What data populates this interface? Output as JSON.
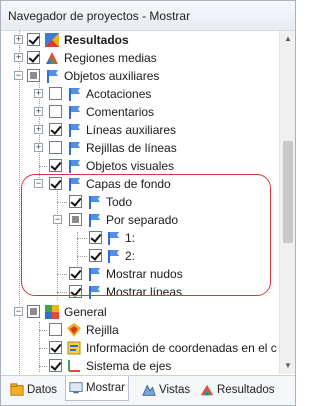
{
  "window": {
    "title": "Navegador de proyectos - Mostrar"
  },
  "tree": [
    {
      "label": "Resultados",
      "bold": true,
      "expander": "+",
      "check": "checked",
      "icon": "results-icon"
    },
    {
      "label": "Regiones medias",
      "expander": "+",
      "check": "checked",
      "icon": "surfaces-icon"
    },
    {
      "label": "Objetos auxiliares",
      "expander": "-",
      "check": "partial",
      "icon": "flag-icon"
    },
    {
      "label": "Acotaciones",
      "expander": "+",
      "check": "unchecked",
      "icon": "flag-icon"
    },
    {
      "label": "Comentarios",
      "expander": "+",
      "check": "unchecked",
      "icon": "flag-icon"
    },
    {
      "label": "Líneas auxiliares",
      "expander": "+",
      "check": "checked",
      "icon": "flag-icon"
    },
    {
      "label": "Rejillas de líneas",
      "expander": "+",
      "check": "unchecked",
      "icon": "flag-icon"
    },
    {
      "label": "Objetos visuales",
      "check": "checked",
      "icon": "flag-icon"
    },
    {
      "label": "Capas de fondo",
      "expander": "-",
      "check": "checked",
      "icon": "flag-icon"
    },
    {
      "label": "Todo",
      "check": "checked",
      "icon": "flag-icon"
    },
    {
      "label": "Por separado",
      "expander": "-",
      "check": "partial",
      "icon": "flag-icon"
    },
    {
      "label": "1:",
      "check": "checked",
      "icon": "flag-icon"
    },
    {
      "label": "2:",
      "check": "checked",
      "icon": "flag-icon"
    },
    {
      "label": "Mostrar nudos",
      "check": "checked",
      "icon": "flag-icon"
    },
    {
      "label": "Mostrar líneas",
      "check": "checked",
      "icon": "flag-icon"
    },
    {
      "label": "General",
      "expander": "-",
      "check": "partial",
      "icon": "general-icon"
    },
    {
      "label": "Rejilla",
      "check": "unchecked",
      "icon": "grid-icon"
    },
    {
      "label": "Información de coordenadas en el c",
      "check": "checked",
      "icon": "coordinate-icon"
    },
    {
      "label": "Sistema de ejes",
      "check": "checked",
      "icon": "axes-icon"
    }
  ],
  "tabs": [
    {
      "label": "Datos",
      "icon": "data-icon",
      "active": false
    },
    {
      "label": "Mostrar",
      "icon": "display-icon",
      "active": true
    },
    {
      "label": "Vistas",
      "icon": "views-icon",
      "active": false
    },
    {
      "label": "Resultados",
      "icon": "results-icon",
      "active": false
    }
  ],
  "scrollbar": {
    "up_arrow": "▲",
    "down_arrow": "▼"
  },
  "colors": {
    "highlight": "#d6363c",
    "accent": "#2e6fd1"
  }
}
